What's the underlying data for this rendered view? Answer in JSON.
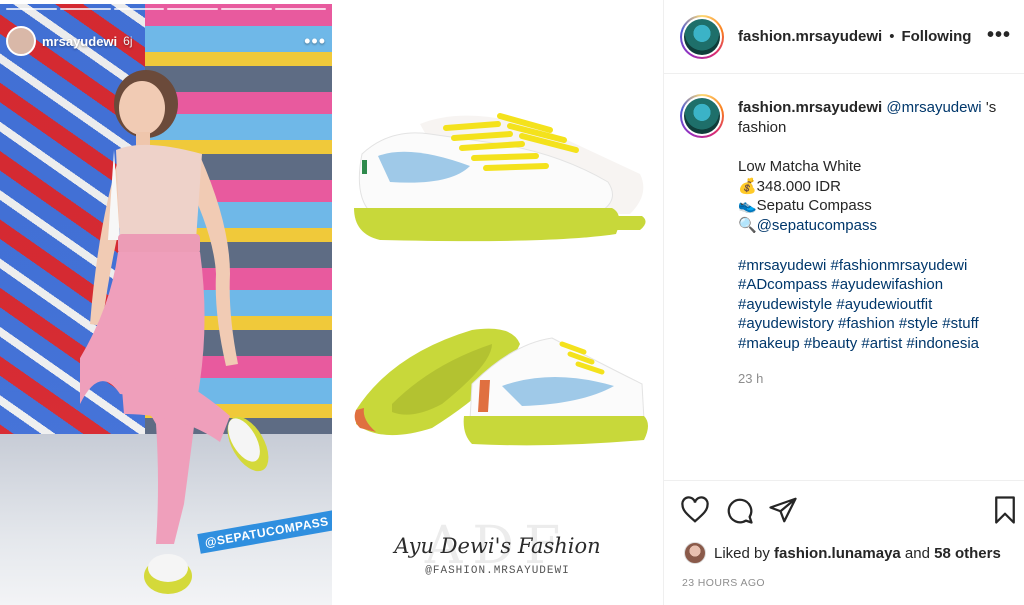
{
  "story": {
    "username": "mrsayudewi",
    "time": "6j",
    "more": "•••",
    "tag": "@SEPATUCOMPASS"
  },
  "product": {
    "watermark_big": "ADF",
    "watermark_script": "Ayu Dewi's Fashion",
    "watermark_handle": "@FASHION.MRSAYUDEWI"
  },
  "header": {
    "username": "fashion.mrsayudewi",
    "separator": "•",
    "follow_label": "Following",
    "options": "•••"
  },
  "caption": {
    "username": "fashion.mrsayudewi",
    "mention": "@mrsayudewi",
    "suffix": " 's fashion",
    "lines": [
      "Low Matcha White",
      "💰348.000 IDR",
      "👟Sepatu Compass",
      "🔍"
    ],
    "shop_handle": "@sepatucompass",
    "hashtags": [
      "#mrsayudewi #fashionmrsayudewi",
      "#ADcompass #ayudewifashion",
      "#ayudewistyle #ayudewioutfit",
      "#ayudewistory #fashion #style #stuff",
      "#makeup #beauty #artist #indonesia"
    ],
    "age": "23 h"
  },
  "likes": {
    "prefix": "Liked by ",
    "user": "fashion.lunamaya",
    "middle": " and ",
    "others": "58 others"
  },
  "timestamp": "23 HOURS AGO",
  "colors": {
    "link": "#00376b",
    "text": "#262626",
    "muted": "#8e8e8e",
    "shoe_sole": "#c8d83a",
    "shoe_swoosh": "#9fc9e8",
    "laces": "#f4e21c"
  },
  "icons": [
    "heart-icon",
    "comment-icon",
    "share-icon",
    "bookmark-icon"
  ]
}
